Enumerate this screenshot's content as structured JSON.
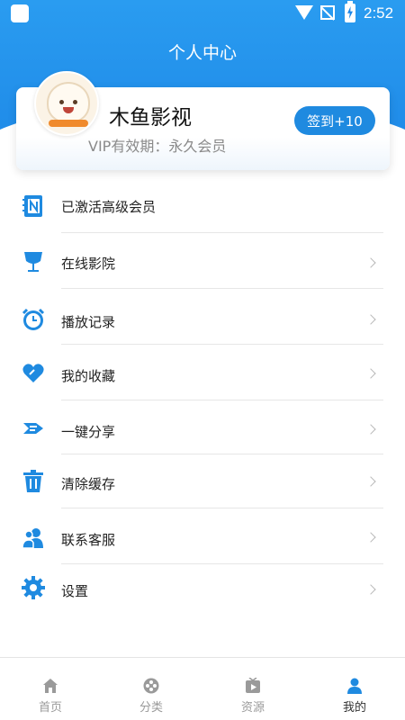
{
  "status_bar": {
    "time": "2:52"
  },
  "header": {
    "title": "个人中心"
  },
  "profile": {
    "name": "木鱼影视",
    "vip_text": "VIP有效期：永久会员",
    "signin_label": "签到+10"
  },
  "menu": [
    {
      "label": "已激活高级会员",
      "icon": "notebook-n-icon",
      "has_arrow": false
    },
    {
      "label": "在线影院",
      "icon": "goblet-icon",
      "has_arrow": true
    },
    {
      "label": "播放记录",
      "icon": "alarm-clock-icon",
      "has_arrow": true
    },
    {
      "label": "我的收藏",
      "icon": "heart-icon",
      "has_arrow": true
    },
    {
      "label": "一键分享",
      "icon": "share-plane-icon",
      "has_arrow": true
    },
    {
      "label": "清除缓存",
      "icon": "trash-icon",
      "has_arrow": true
    },
    {
      "label": "联系客服",
      "icon": "users-icon",
      "has_arrow": true
    },
    {
      "label": "设置",
      "icon": "gear-icon",
      "has_arrow": true
    }
  ],
  "bottom_nav": [
    {
      "label": "首页",
      "icon": "home-icon",
      "active": false
    },
    {
      "label": "分类",
      "icon": "category-icon",
      "active": false
    },
    {
      "label": "资源",
      "icon": "resource-icon",
      "active": false
    },
    {
      "label": "我的",
      "icon": "profile-icon",
      "active": true
    }
  ],
  "colors": {
    "primary": "#1f8ae0",
    "inactive": "#9a9a9a"
  }
}
